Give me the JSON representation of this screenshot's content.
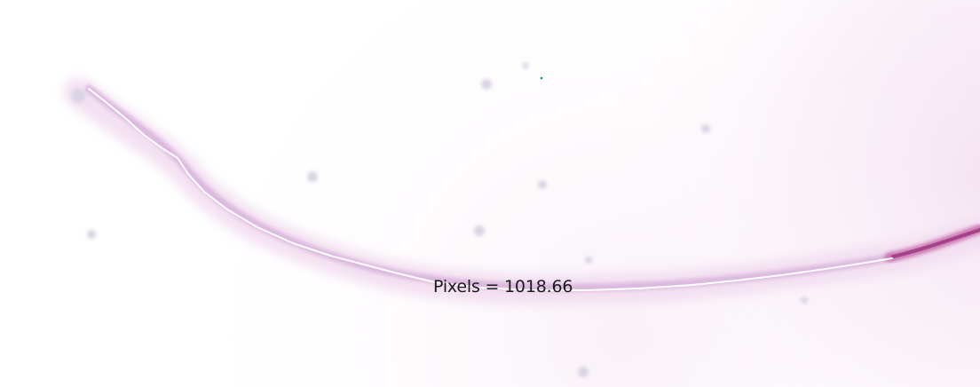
{
  "measurement": {
    "label_text": "Pixels = 1018.66",
    "value": 1018.66,
    "unit": "Pixels"
  },
  "colors": {
    "background": "#ffffff",
    "tissue_tint": "#f5e6f3",
    "tissue_tint_deep": "#edd4ea",
    "fiber_edge": "#d9b3dd",
    "fiber_core": "#ffffff",
    "fiber_stain": "#b44a94",
    "speck": "#d8d3e2",
    "label_text": "#1a1a1a"
  },
  "icons": {
    "trace": "measurement-polyline"
  }
}
